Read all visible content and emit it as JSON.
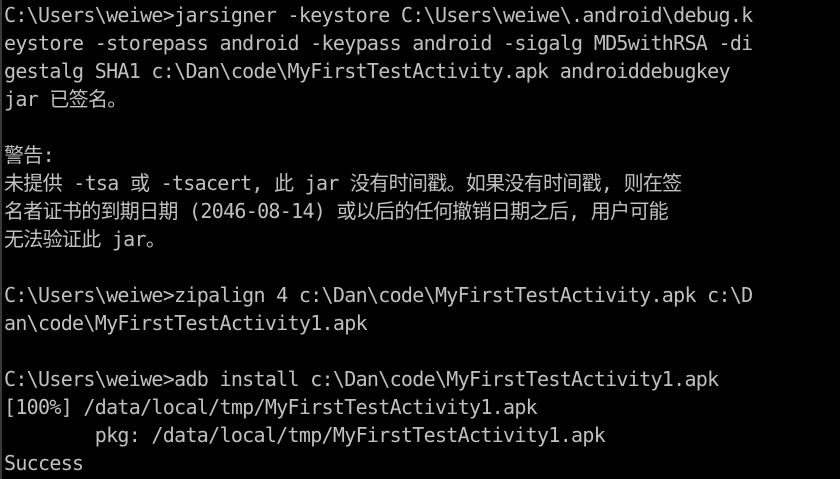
{
  "console": {
    "lines": [
      "C:\\Users\\weiwe>jarsigner -keystore C:\\Users\\weiwe\\.android\\debug.k",
      "eystore -storepass android -keypass android -sigalg MD5withRSA -di",
      "gestalg SHA1 c:\\Dan\\code\\MyFirstTestActivity.apk androiddebugkey",
      "jar 已签名。",
      "",
      "警告:",
      "未提供 -tsa 或 -tsacert, 此 jar 没有时间戳。如果没有时间戳, 则在签",
      "名者证书的到期日期 (2046-08-14) 或以后的任何撤销日期之后, 用户可能",
      "无法验证此 jar。",
      "",
      "C:\\Users\\weiwe>zipalign 4 c:\\Dan\\code\\MyFirstTestActivity.apk c:\\D",
      "an\\code\\MyFirstTestActivity1.apk",
      "",
      "C:\\Users\\weiwe>adb install c:\\Dan\\code\\MyFirstTestActivity1.apk",
      "[100%] /data/local/tmp/MyFirstTestActivity1.apk",
      "        pkg: /data/local/tmp/MyFirstTestActivity1.apk",
      "Success"
    ]
  },
  "colors": {
    "background": "#000000",
    "text": "#c0c0c0"
  }
}
